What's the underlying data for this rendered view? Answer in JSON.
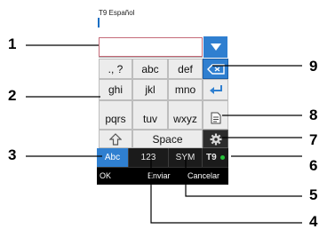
{
  "screen": {
    "title": "T9 Español",
    "input_value": ""
  },
  "keypad": {
    "rows": [
      [
        "., ?",
        "abc",
        "def"
      ],
      [
        "ghi",
        "jkl",
        "mno"
      ],
      [
        "pqrs",
        "tuv",
        "wxyz"
      ]
    ],
    "space_label": "Space"
  },
  "mode_bar": {
    "abc_label": "Abc",
    "num_label": "123",
    "sym_label": "SYM",
    "t9_label": "T9"
  },
  "softkeys": {
    "left": "OK",
    "center": "Enviar",
    "right": "Cancelar"
  },
  "callouts": [
    "1",
    "2",
    "3",
    "4",
    "5",
    "6",
    "7",
    "8",
    "9"
  ],
  "colors": {
    "accent_blue": "#2f7fd0",
    "t9_indicator": "#27c13a"
  },
  "icons": [
    "dropdown-arrow-icon",
    "backspace-icon",
    "enter-icon",
    "shift-icon",
    "menu-icon",
    "settings-icon"
  ]
}
